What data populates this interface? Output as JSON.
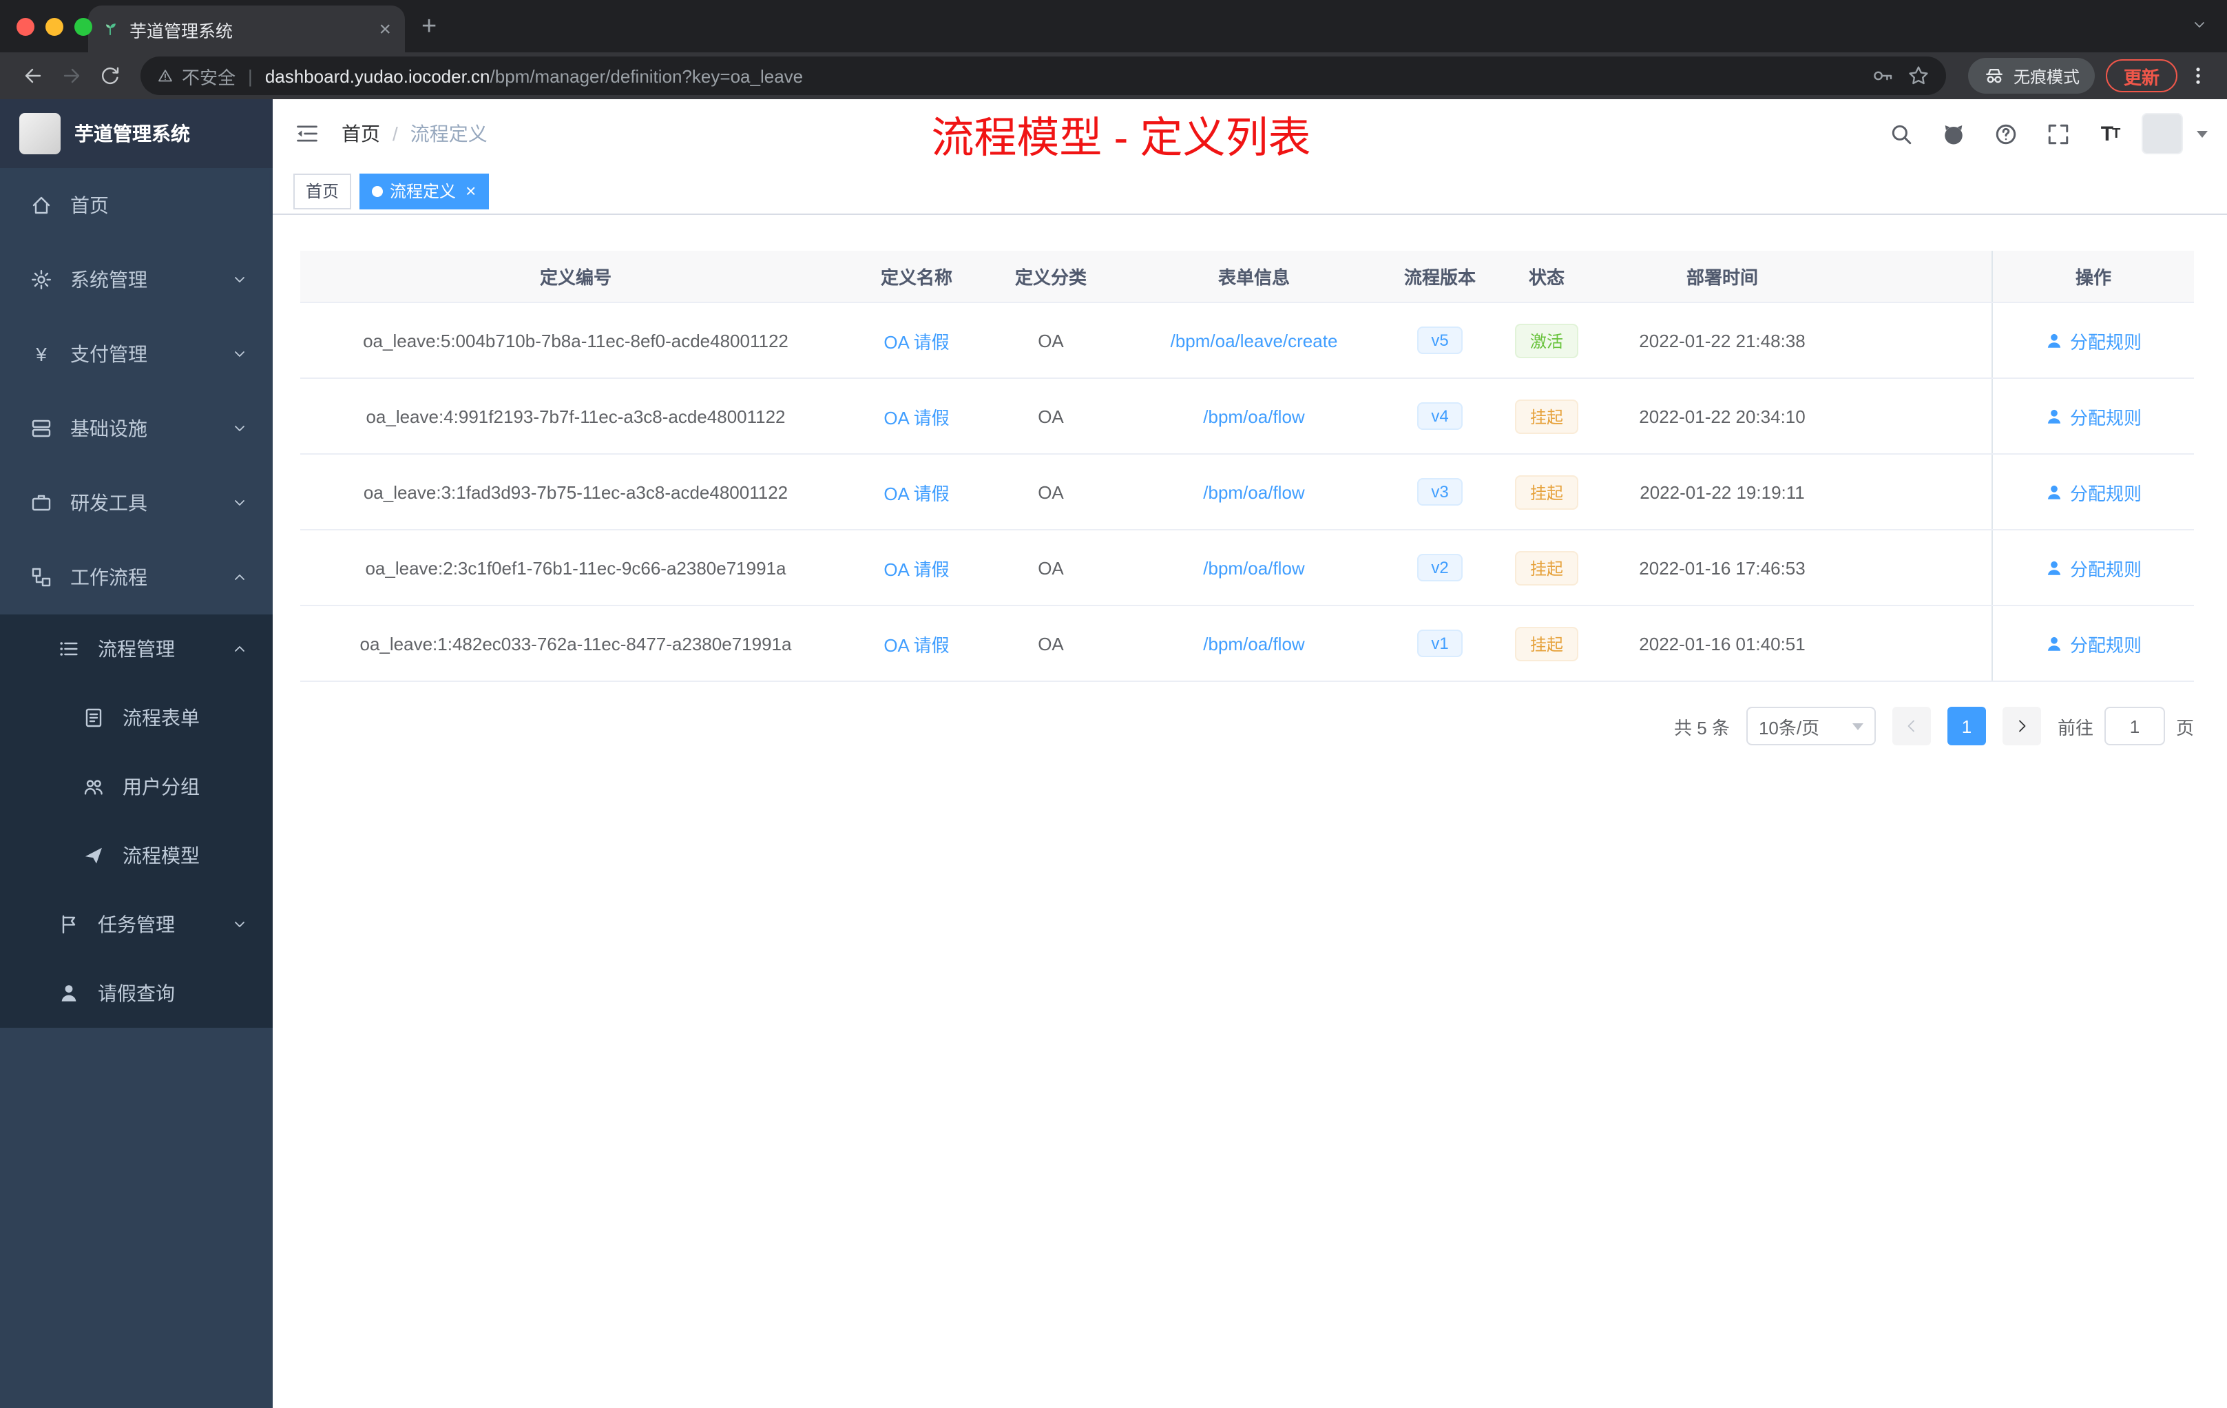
{
  "colors": {
    "accent_blue": "#409eff",
    "success_green": "#67c23a",
    "warning_orange": "#e6a23c",
    "annotation_red": "#f01414",
    "sidebar_bg": "#304156",
    "sidebar_submenu_bg": "#1f2d3d",
    "update_red": "#f0574a"
  },
  "icons": {
    "plus": "+",
    "close": "×",
    "yen": "¥",
    "font_size_large": "T",
    "font_size_small": "T"
  },
  "browser": {
    "tab_title": "芋道管理系统",
    "security_label": "不安全",
    "url_divider": "|",
    "url_domain": "dashboard.yudao.iocoder.cn",
    "url_path": "/bpm/manager/definition?key=oa_leave",
    "incognito_label": "无痕模式",
    "update_label": "更新"
  },
  "sidebar": {
    "logo_title": "芋道管理系统",
    "items": {
      "home": "首页",
      "system": "系统管理",
      "payment": "支付管理",
      "infra": "基础设施",
      "devtools": "研发工具",
      "workflow": "工作流程",
      "process_mgmt": "流程管理",
      "process_form": "流程表单",
      "user_group": "用户分组",
      "process_model": "流程模型",
      "task_mgmt": "任务管理",
      "leave_query": "请假查询"
    }
  },
  "navbar": {
    "breadcrumb_home": "首页",
    "breadcrumb_sep": "/",
    "breadcrumb_current": "流程定义",
    "annotation": "流程模型 - 定义列表"
  },
  "tags": {
    "home": "首页",
    "current": "流程定义"
  },
  "table": {
    "columns": {
      "id": "定义编号",
      "name": "定义名称",
      "category": "定义分类",
      "form": "表单信息",
      "version": "流程版本",
      "status": "状态",
      "deploy_time": "部署时间",
      "actions": "操作"
    },
    "rows": [
      {
        "id": "oa_leave:5:004b710b-7b8a-11ec-8ef0-acde48001122",
        "name": "OA 请假",
        "category": "OA",
        "form": "/bpm/oa/leave/create",
        "version": "v5",
        "status": "激活",
        "status_type": "success",
        "deploy_time": "2022-01-22 21:48:38",
        "action": "分配规则"
      },
      {
        "id": "oa_leave:4:991f2193-7b7f-11ec-a3c8-acde48001122",
        "name": "OA 请假",
        "category": "OA",
        "form": "/bpm/oa/flow",
        "version": "v4",
        "status": "挂起",
        "status_type": "warning",
        "deploy_time": "2022-01-22 20:34:10",
        "action": "分配规则"
      },
      {
        "id": "oa_leave:3:1fad3d93-7b75-11ec-a3c8-acde48001122",
        "name": "OA 请假",
        "category": "OA",
        "form": "/bpm/oa/flow",
        "version": "v3",
        "status": "挂起",
        "status_type": "warning",
        "deploy_time": "2022-01-22 19:19:11",
        "action": "分配规则"
      },
      {
        "id": "oa_leave:2:3c1f0ef1-76b1-11ec-9c66-a2380e71991a",
        "name": "OA 请假",
        "category": "OA",
        "form": "/bpm/oa/flow",
        "version": "v2",
        "status": "挂起",
        "status_type": "warning",
        "deploy_time": "2022-01-16 17:46:53",
        "action": "分配规则"
      },
      {
        "id": "oa_leave:1:482ec033-762a-11ec-8477-a2380e71991a",
        "name": "OA 请假",
        "category": "OA",
        "form": "/bpm/oa/flow",
        "version": "v1",
        "status": "挂起",
        "status_type": "warning",
        "deploy_time": "2022-01-16 01:40:51",
        "action": "分配规则"
      }
    ]
  },
  "pagination": {
    "total": "共 5 条",
    "page_size": "10条/页",
    "current_page": "1",
    "goto_label": "前往",
    "goto_value": "1",
    "page_unit": "页"
  }
}
